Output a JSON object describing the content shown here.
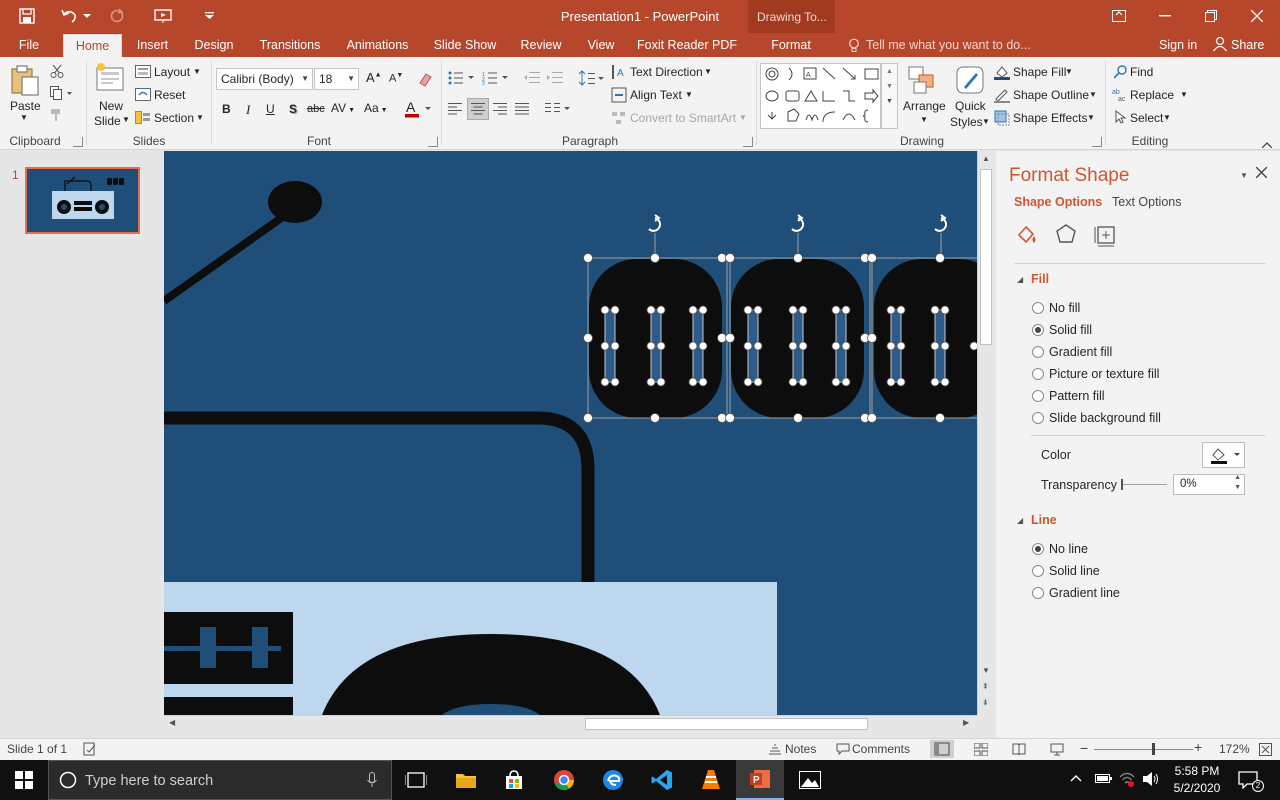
{
  "titlebar": {
    "window_title": "Presentation1 - PowerPoint",
    "context_group": "Drawing To..."
  },
  "tabs": [
    "File",
    "Home",
    "Insert",
    "Design",
    "Transitions",
    "Animations",
    "Slide Show",
    "Review",
    "View",
    "Foxit Reader PDF",
    "Format"
  ],
  "tell_me": "Tell me what you want to do...",
  "sign_in": "Sign in",
  "share": "Share",
  "ribbon": {
    "clipboard": {
      "paste": "Paste",
      "label": "Clipboard"
    },
    "slides": {
      "new_slide_1": "New",
      "new_slide_2": "Slide",
      "layout": "Layout",
      "reset": "Reset",
      "section": "Section",
      "label": "Slides"
    },
    "font": {
      "font_name": "Calibri (Body)",
      "font_size": "18",
      "label": "Font"
    },
    "paragraph": {
      "text_direction": "Text Direction",
      "align_text": "Align Text",
      "convert_smartart": "Convert to SmartArt",
      "label": "Paragraph"
    },
    "drawing": {
      "arrange": "Arrange",
      "quick_styles_1": "Quick",
      "quick_styles_2": "Styles",
      "shape_fill": "Shape Fill",
      "shape_outline": "Shape Outline",
      "shape_effects": "Shape Effects",
      "label": "Drawing"
    },
    "editing": {
      "find": "Find",
      "replace": "Replace",
      "select": "Select",
      "label": "Editing"
    }
  },
  "slides_panel": {
    "number": "1"
  },
  "format_pane": {
    "title": "Format Shape",
    "tab_shape": "Shape Options",
    "tab_text": "Text Options",
    "fill_header": "Fill",
    "fill_options": [
      {
        "label": "No fill",
        "selected": false
      },
      {
        "label": "Solid fill",
        "selected": true
      },
      {
        "label": "Gradient fill",
        "selected": false
      },
      {
        "label": "Picture or texture fill",
        "selected": false
      },
      {
        "label": "Pattern fill",
        "selected": false
      },
      {
        "label": "Slide background fill",
        "selected": false
      }
    ],
    "color_label": "Color",
    "transparency_label": "Transparency",
    "transparency_value": "0%",
    "line_header": "Line",
    "line_options": [
      {
        "label": "No line",
        "selected": true
      },
      {
        "label": "Solid line",
        "selected": false
      },
      {
        "label": "Gradient line",
        "selected": false
      }
    ]
  },
  "status": {
    "slide_info": "Slide 1 of 1",
    "notes": "Notes",
    "comments": "Comments",
    "zoom": "172%"
  },
  "taskbar": {
    "search_placeholder": "Type here to search",
    "time": "5:58 PM",
    "date": "5/2/2020",
    "notif_count": "2"
  },
  "colors": {
    "accent": "#b7472a",
    "slide_bg": "#1f4e79",
    "light_panel": "#bdd7ee",
    "shape_black": "#0d0d0d"
  }
}
